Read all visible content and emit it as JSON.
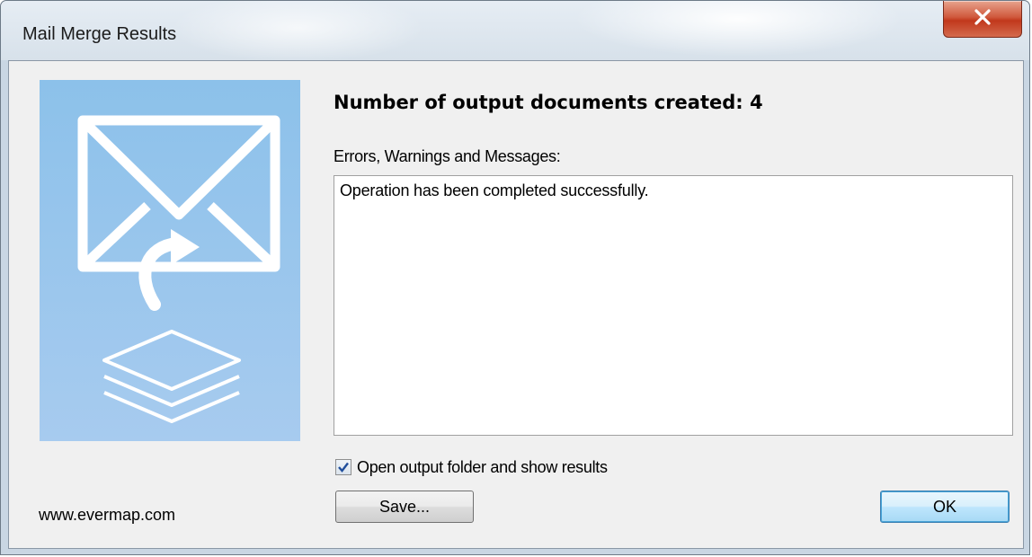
{
  "window": {
    "title": "Mail Merge Results",
    "close_icon": "close-icon"
  },
  "main": {
    "heading": "Number of output documents created: 4",
    "messages_label": "Errors, Warnings and Messages:",
    "messages_text": "Operation has been completed successfully.",
    "open_folder_checkbox": {
      "label": "Open output folder and show results",
      "checked": true
    },
    "save_label": "Save...",
    "ok_label": "OK",
    "website": "www.evermap.com"
  },
  "side_panel": {
    "icons": [
      "envelope-icon",
      "reply-arrow-icon",
      "layers-icon"
    ]
  },
  "colors": {
    "panel_blue": "#a0c9ee",
    "close_red": "#c7472b",
    "ok_blue": "#3c7fb1"
  }
}
